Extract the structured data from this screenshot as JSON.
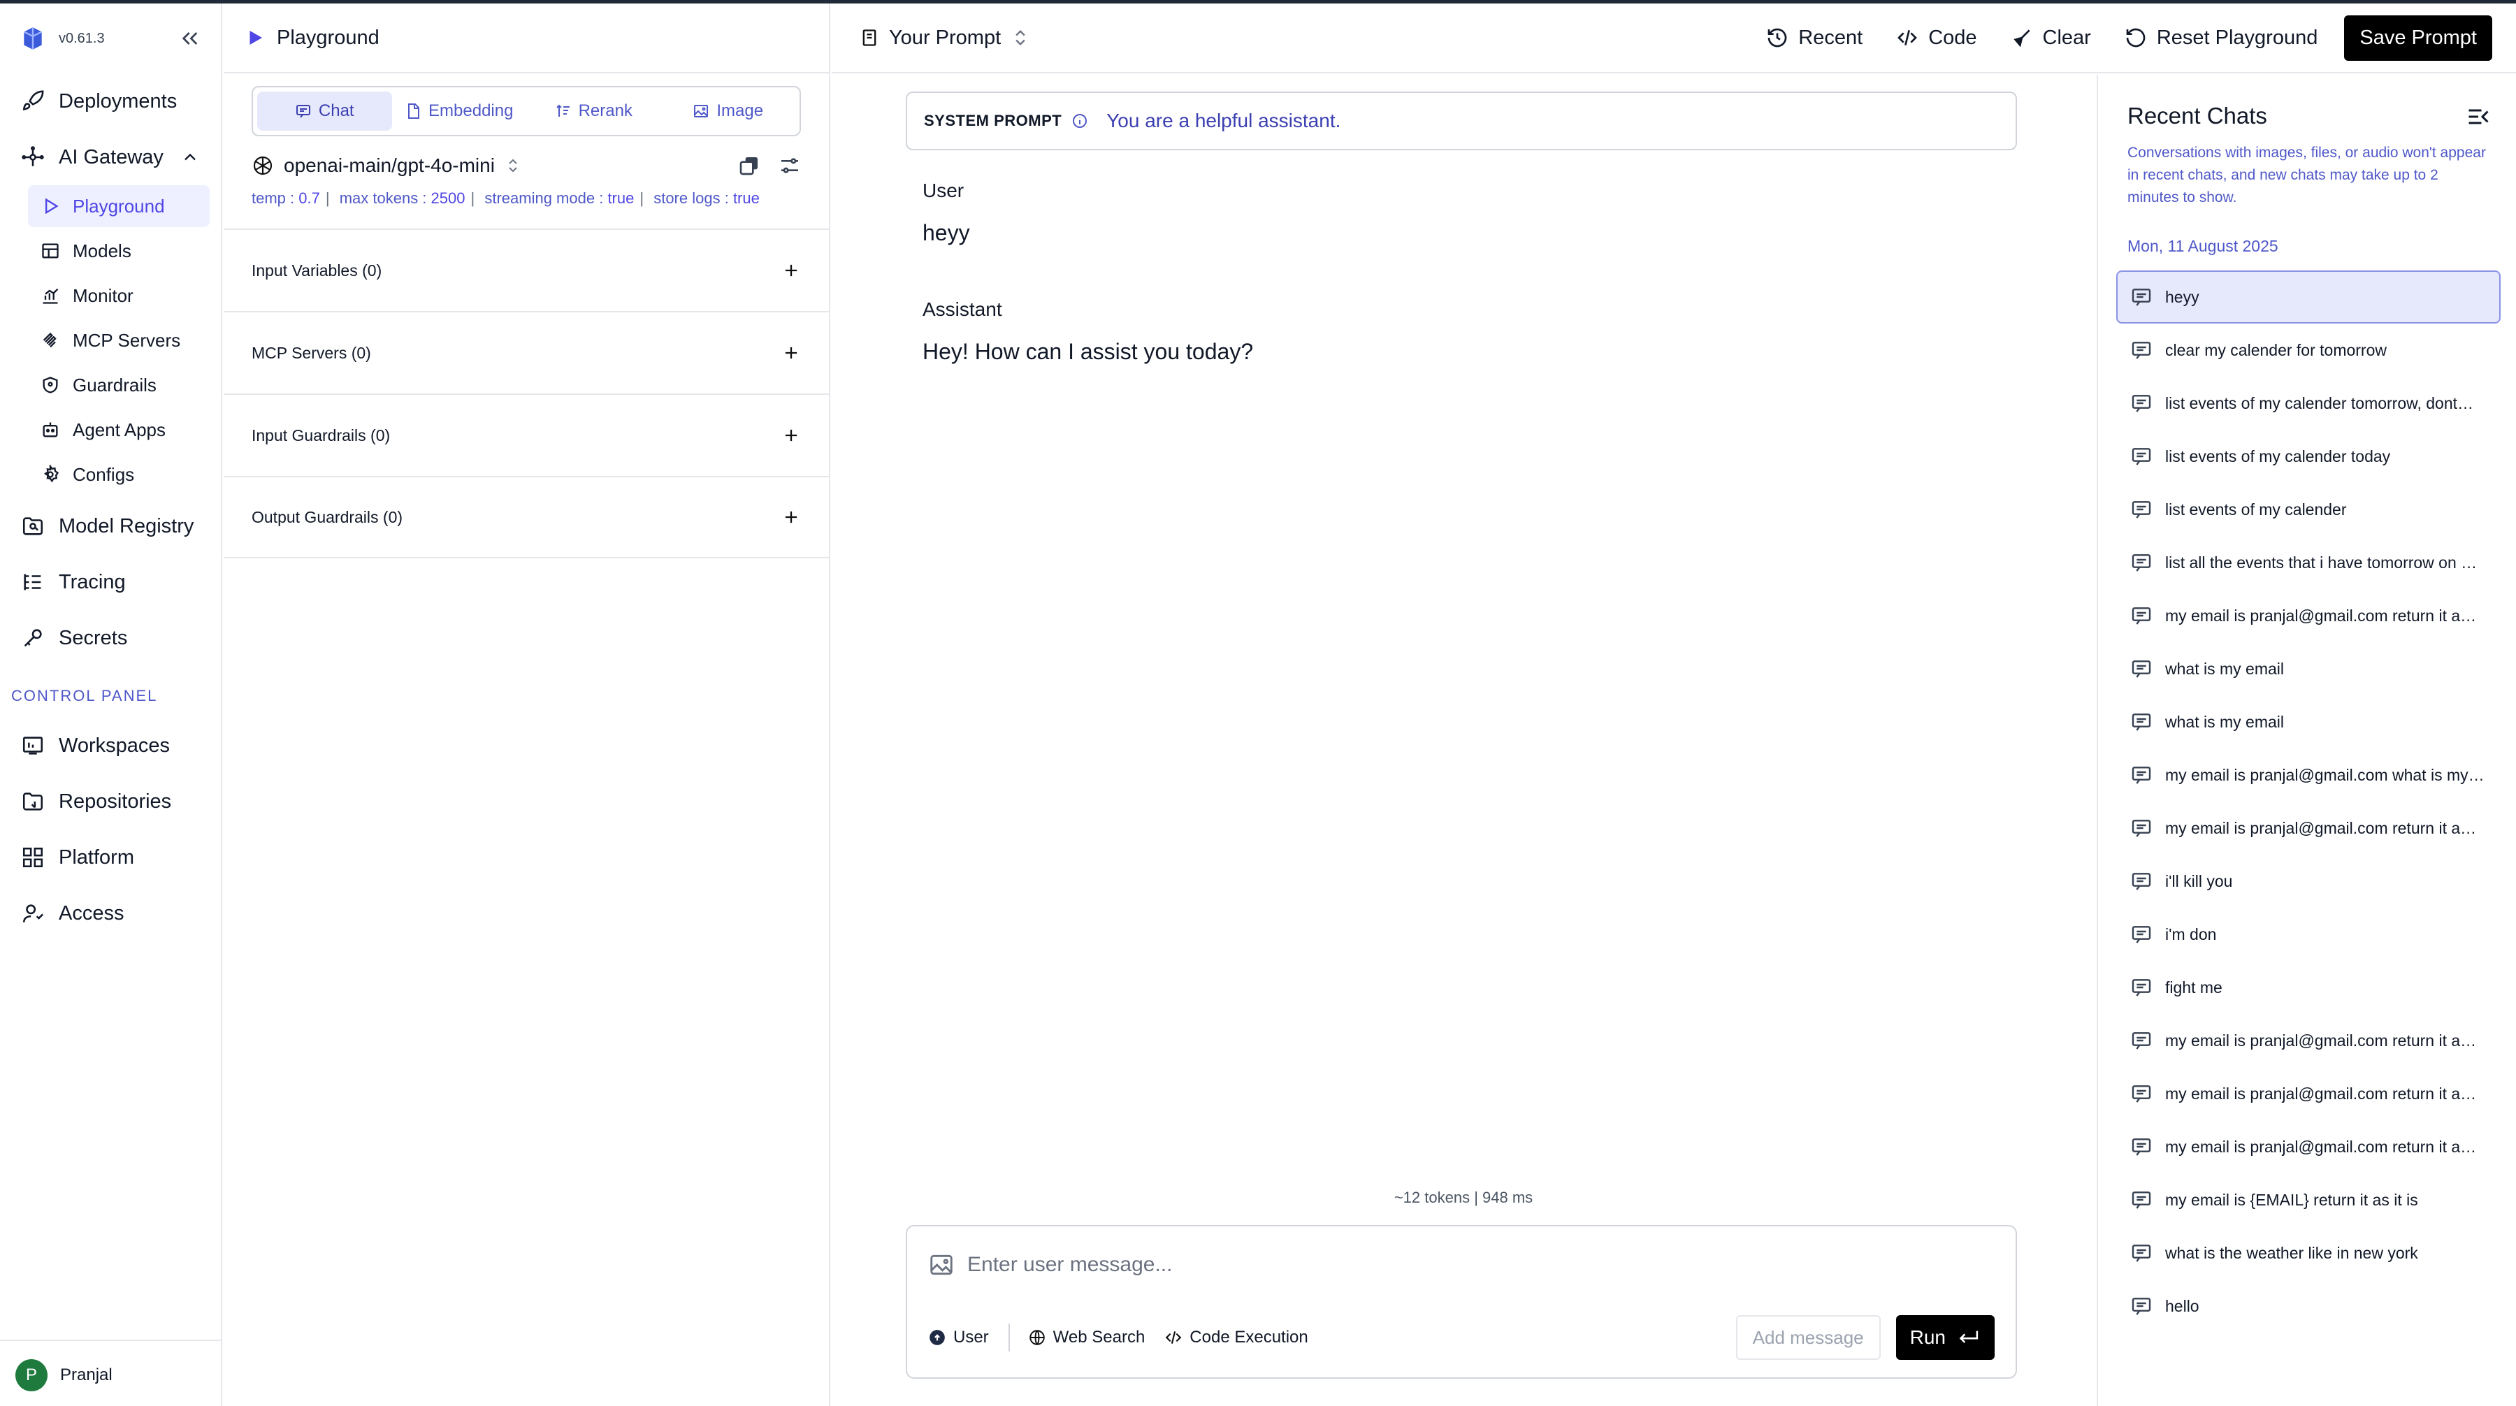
{
  "app": {
    "version": "v0.61.3"
  },
  "sidebar": {
    "items": [
      {
        "label": "Deployments",
        "icon": "rocket-icon"
      },
      {
        "label": "AI Gateway",
        "icon": "gateway-icon",
        "expanded": true
      }
    ],
    "gateway_items": [
      {
        "label": "Playground",
        "icon": "play-icon",
        "active": true
      },
      {
        "label": "Models",
        "icon": "table-icon"
      },
      {
        "label": "Monitor",
        "icon": "chart-icon"
      },
      {
        "label": "MCP Servers",
        "icon": "mcp-icon"
      },
      {
        "label": "Guardrails",
        "icon": "shield-icon"
      },
      {
        "label": "Agent Apps",
        "icon": "agent-icon"
      },
      {
        "label": "Configs",
        "icon": "gear-icon"
      }
    ],
    "more_items": [
      {
        "label": "Model Registry",
        "icon": "registry-icon"
      },
      {
        "label": "Tracing",
        "icon": "tracing-icon"
      },
      {
        "label": "Secrets",
        "icon": "key-icon"
      }
    ],
    "control_panel_label": "CONTROL PANEL",
    "control_items": [
      {
        "label": "Workspaces",
        "icon": "workspaces-icon"
      },
      {
        "label": "Repositories",
        "icon": "repo-icon"
      },
      {
        "label": "Platform",
        "icon": "grid-icon"
      },
      {
        "label": "Access",
        "icon": "users-icon"
      }
    ],
    "user": {
      "initial": "P",
      "name": "Pranjal"
    }
  },
  "config": {
    "header": "Playground",
    "tabs": [
      {
        "label": "Chat",
        "active": true
      },
      {
        "label": "Embedding"
      },
      {
        "label": "Rerank"
      },
      {
        "label": "Image"
      }
    ],
    "model": "openai-main/gpt-4o-mini",
    "params": {
      "temp_label": "temp :",
      "temp": "0.7",
      "max_tokens_label": "max tokens :",
      "max_tokens": "2500",
      "streaming_label": "streaming mode :",
      "streaming": "true",
      "store_logs_label": "store logs :",
      "store_logs": "true"
    },
    "sections": [
      "Input Variables (0)",
      "MCP Servers (0)",
      "Input Guardrails (0)",
      "Output Guardrails (0)"
    ]
  },
  "topbar": {
    "prompt_selector": "Your Prompt",
    "recent": "Recent",
    "code": "Code",
    "clear": "Clear",
    "reset": "Reset Playground",
    "save": "Save Prompt"
  },
  "chat": {
    "system_prompt_label": "SYSTEM PROMPT",
    "system_prompt": "You are a helpful assistant.",
    "messages": [
      {
        "role": "User",
        "text": "heyy"
      },
      {
        "role": "Assistant",
        "text": "Hey! How can I assist you today?"
      }
    ],
    "meta": "~12 tokens | 948 ms",
    "composer": {
      "placeholder": "Enter user message...",
      "role_chip": "User",
      "web_search": "Web Search",
      "code_execution": "Code Execution",
      "add_message": "Add message",
      "run": "Run"
    }
  },
  "recent": {
    "title": "Recent Chats",
    "description": "Conversations with images, files, or audio won't appear in recent chats, and new chats may take up to 2 minutes to show.",
    "date": "Mon, 11 August 2025",
    "items": [
      "heyy",
      "clear my calender for tomorrow",
      "list events of my calender tomorrow, dont…",
      "list events of my calender today",
      "list events of my calender",
      "list all the events that i have tomorrow on …",
      "my email is pranjal@gmail.com return it a…",
      "what is my email",
      "what is my email",
      "my email is pranjal@gmail.com what is my…",
      "my email is pranjal@gmail.com return it a…",
      "i'll kill you",
      "i'm don",
      "fight me",
      "my email is pranjal@gmail.com return it a…",
      "my email is pranjal@gmail.com return it a…",
      "my email is pranjal@gmail.com return it a…",
      "my email is {EMAIL} return it as it is",
      "what is the weather like in new york",
      "hello"
    ]
  },
  "colors": {
    "accent": "#4f46e5",
    "active_bg": "#eef0ff",
    "muted_link": "#4f58c8"
  }
}
